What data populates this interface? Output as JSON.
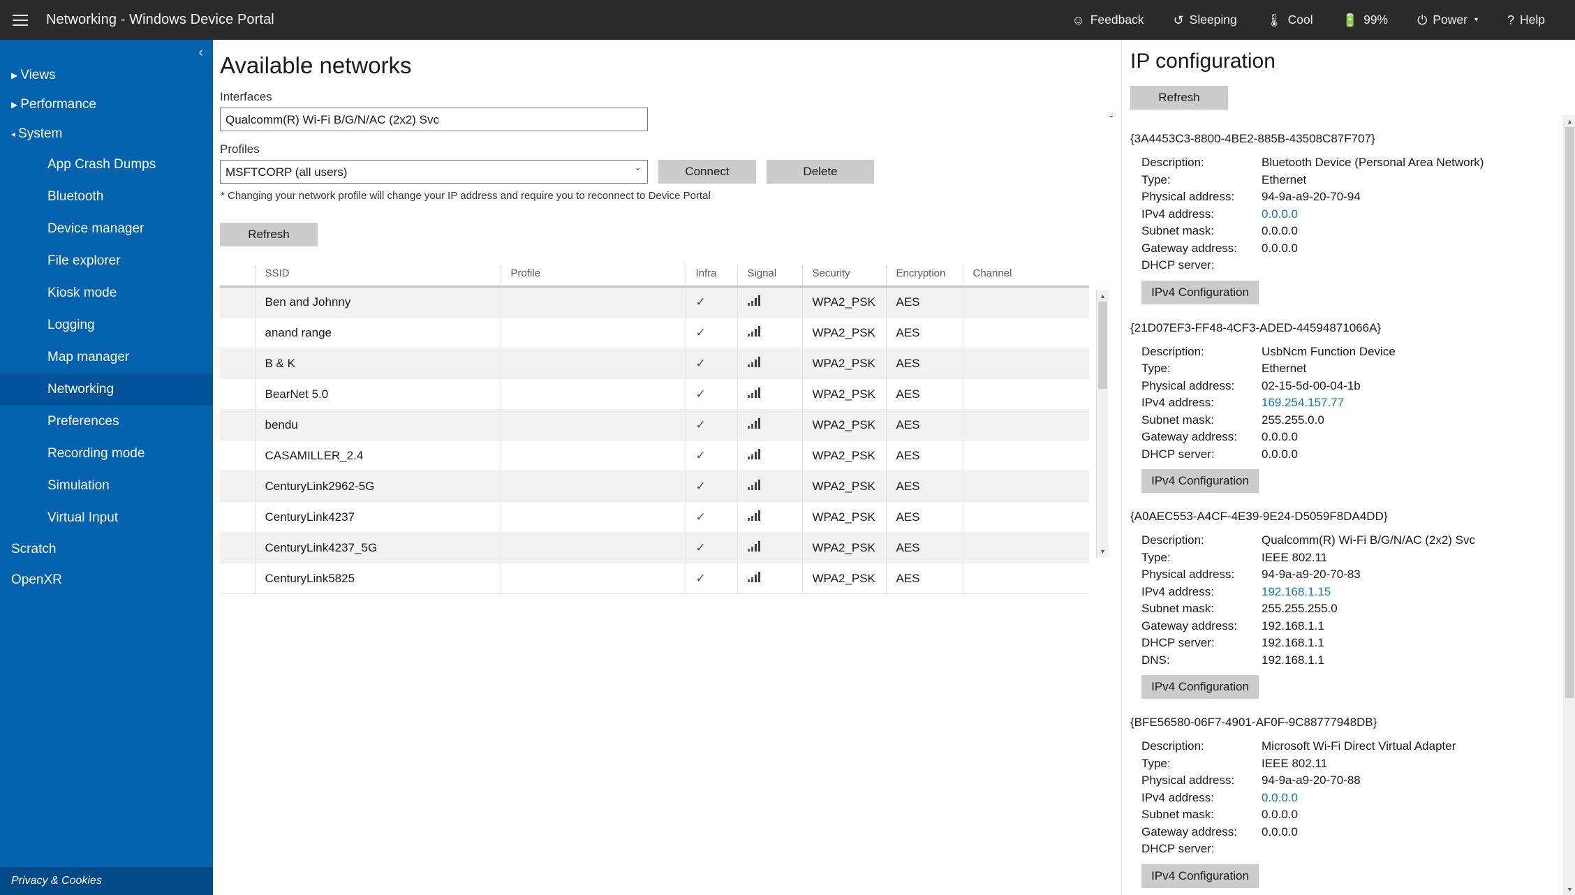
{
  "topbar": {
    "menu_icon": "hamburger-icon",
    "title": "Networking - Windows Device Portal",
    "items": [
      {
        "icon": "smiley-icon",
        "glyph": "☺",
        "label": "Feedback",
        "caret": ""
      },
      {
        "icon": "history-icon",
        "glyph": "↺",
        "label": "Sleeping",
        "caret": ""
      },
      {
        "icon": "thermometer-icon",
        "glyph": "¡",
        "label": "Cool",
        "caret": ""
      },
      {
        "icon": "battery-icon",
        "glyph": "▬",
        "label": "99%",
        "caret": ""
      },
      {
        "icon": "power-icon",
        "glyph": "⏻",
        "label": "Power",
        "caret": "▾"
      },
      {
        "icon": "help-icon",
        "glyph": "?",
        "label": "Help",
        "caret": ""
      }
    ]
  },
  "sidebar": {
    "collapse_glyph": "‹",
    "groups": [
      {
        "label": "Views",
        "tri": "▶",
        "expanded": false
      },
      {
        "label": "Performance",
        "tri": "▶",
        "expanded": false
      },
      {
        "label": "System",
        "tri": "◂",
        "expanded": true
      }
    ],
    "system_items": [
      "App Crash Dumps",
      "Bluetooth",
      "Device manager",
      "File explorer",
      "Kiosk mode",
      "Logging",
      "Map manager",
      "Networking",
      "Preferences",
      "Recording mode",
      "Simulation",
      "Virtual Input"
    ],
    "active_item": "Networking",
    "plain_items": [
      "Scratch",
      "OpenXR"
    ],
    "privacy": "Privacy & Cookies",
    "accent": "#0262ad",
    "accent_active": "#005299"
  },
  "main": {
    "title": "Available networks",
    "interfaces_label": "Interfaces",
    "interfaces_value": "Qualcomm(R) Wi-Fi B/G/N/AC (2x2) Svc",
    "interfaces_options": [
      "Qualcomm(R) Wi-Fi B/G/N/AC (2x2) Svc"
    ],
    "profiles_label": "Profiles",
    "profiles_value": "MSFTCORP (all users)",
    "profiles_options": [
      "MSFTCORP (all users)"
    ],
    "connect_label": "Connect",
    "delete_label": "Delete",
    "note": "* Changing your network profile will change your IP address and require you to reconnect to Device Portal",
    "refresh_label": "Refresh",
    "chevron": "ˇ"
  },
  "table": {
    "columns": [
      "",
      "SSID",
      "Profile",
      "Infra",
      "Signal",
      "Security",
      "Encryption",
      "Channel"
    ],
    "check_glyph": "✓",
    "rows": [
      {
        "ssid": "Ben and Johnny",
        "profile": "",
        "infra": true,
        "signal": 4,
        "security": "WPA2_PSK",
        "encryption": "AES",
        "channel": ""
      },
      {
        "ssid": "anand range",
        "profile": "",
        "infra": true,
        "signal": 4,
        "security": "WPA2_PSK",
        "encryption": "AES",
        "channel": ""
      },
      {
        "ssid": "B & K",
        "profile": "",
        "infra": true,
        "signal": 4,
        "security": "WPA2_PSK",
        "encryption": "AES",
        "channel": ""
      },
      {
        "ssid": "BearNet 5.0",
        "profile": "",
        "infra": true,
        "signal": 4,
        "security": "WPA2_PSK",
        "encryption": "AES",
        "channel": ""
      },
      {
        "ssid": "bendu",
        "profile": "",
        "infra": true,
        "signal": 4,
        "security": "WPA2_PSK",
        "encryption": "AES",
        "channel": ""
      },
      {
        "ssid": "CASAMILLER_2.4",
        "profile": "",
        "infra": true,
        "signal": 4,
        "security": "WPA2_PSK",
        "encryption": "AES",
        "channel": ""
      },
      {
        "ssid": "CenturyLink2962-5G",
        "profile": "",
        "infra": true,
        "signal": 4,
        "security": "WPA2_PSK",
        "encryption": "AES",
        "channel": ""
      },
      {
        "ssid": "CenturyLink4237",
        "profile": "",
        "infra": true,
        "signal": 4,
        "security": "WPA2_PSK",
        "encryption": "AES",
        "channel": ""
      },
      {
        "ssid": "CenturyLink4237_5G",
        "profile": "",
        "infra": true,
        "signal": 4,
        "security": "WPA2_PSK",
        "encryption": "AES",
        "channel": ""
      },
      {
        "ssid": "CenturyLink5825",
        "profile": "",
        "infra": true,
        "signal": 4,
        "security": "WPA2_PSK",
        "encryption": "AES",
        "channel": ""
      }
    ]
  },
  "ipconfig": {
    "title": "IP configuration",
    "refresh_label": "Refresh",
    "ipv4_button_label": "IPv4 Configuration",
    "keys": {
      "description": "Description:",
      "type": "Type:",
      "physical": "Physical address:",
      "ipv4": "IPv4 address:",
      "subnet": "Subnet mask:",
      "gateway": "Gateway address:",
      "dhcp": "DHCP server:",
      "dns": "DNS:"
    },
    "link_color": "#1673c0",
    "adapters": [
      {
        "guid": "{3A4453C3-8800-4BE2-885B-43508C87F707}",
        "description": "Bluetooth Device (Personal Area Network)",
        "type": "Ethernet",
        "physical": "94-9a-a9-20-70-94",
        "ipv4": "0.0.0.0",
        "subnet": "0.0.0.0",
        "gateway": "0.0.0.0",
        "dhcp": "",
        "dns": null
      },
      {
        "guid": "{21D07EF3-FF48-4CF3-ADED-44594871066A}",
        "description": "UsbNcm Function Device",
        "type": "Ethernet",
        "physical": "02-15-5d-00-04-1b",
        "ipv4": "169.254.157.77",
        "subnet": "255.255.0.0",
        "gateway": "0.0.0.0",
        "dhcp": "0.0.0.0",
        "dns": null
      },
      {
        "guid": "{A0AEC553-A4CF-4E39-9E24-D5059F8DA4DD}",
        "description": "Qualcomm(R) Wi-Fi B/G/N/AC (2x2) Svc",
        "type": "IEEE 802.11",
        "physical": "94-9a-a9-20-70-83",
        "ipv4": "192.168.1.15",
        "subnet": "255.255.255.0",
        "gateway": "192.168.1.1",
        "dhcp": "192.168.1.1",
        "dns": "192.168.1.1"
      },
      {
        "guid": "{BFE56580-06F7-4901-AF0F-9C88777948DB}",
        "description": "Microsoft Wi-Fi Direct Virtual Adapter",
        "type": "IEEE 802.11",
        "physical": "94-9a-a9-20-70-88",
        "ipv4": "0.0.0.0",
        "subnet": "0.0.0.0",
        "gateway": "0.0.0.0",
        "dhcp": "",
        "dns": null
      }
    ]
  },
  "scroll": {
    "up": "▲",
    "down": "▼"
  }
}
